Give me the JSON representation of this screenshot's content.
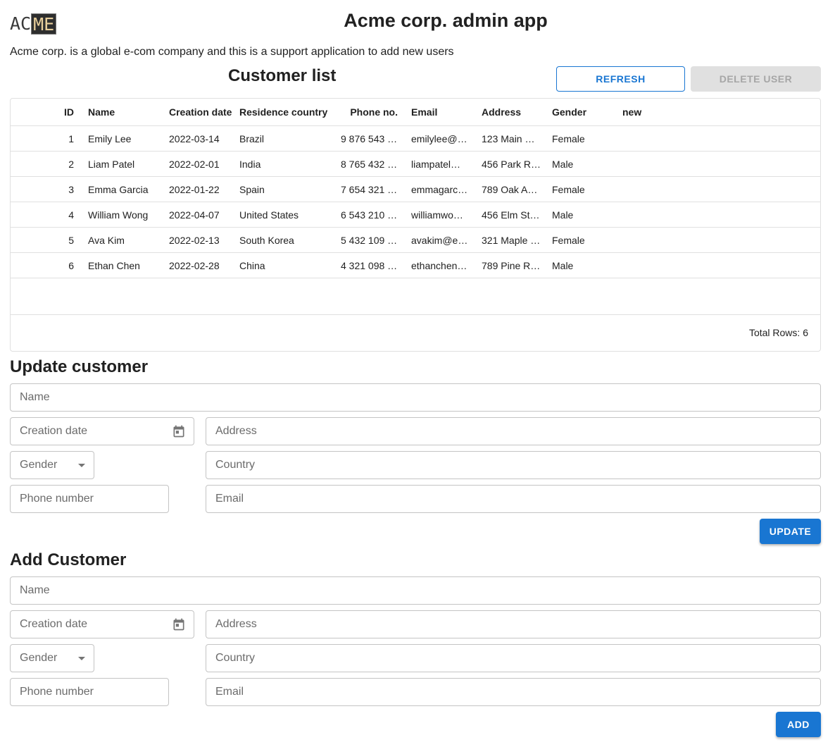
{
  "logo": {
    "plain": "AC",
    "boxed": "ME"
  },
  "app_title": "Acme corp. admin app",
  "intro": "Acme corp. is a global e-com company and this is a support application to add new users",
  "list_title": "Customer list",
  "buttons": {
    "refresh": "REFRESH",
    "delete": "DELETE USER",
    "update": "UPDATE",
    "add": "ADD"
  },
  "table": {
    "columns": [
      "ID",
      "Name",
      "Creation date",
      "Residence country",
      "Phone no.",
      "Email",
      "Address",
      "Gender",
      "new"
    ],
    "rows": [
      [
        "1",
        "Emily Lee",
        "2022-03-14",
        "Brazil",
        "9 876 543 …",
        "emilylee@…",
        "123 Main …",
        "Female",
        ""
      ],
      [
        "2",
        "Liam Patel",
        "2022-02-01",
        "India",
        "8 765 432 …",
        "liampatel…",
        "456 Park R…",
        "Male",
        ""
      ],
      [
        "3",
        "Emma Garcia",
        "2022-01-22",
        "Spain",
        "7 654 321 …",
        "emmagarc…",
        "789 Oak A…",
        "Female",
        ""
      ],
      [
        "4",
        "William Wong",
        "2022-04-07",
        "United States",
        "6 543 210 …",
        "williamwo…",
        "456 Elm St…",
        "Male",
        ""
      ],
      [
        "5",
        "Ava Kim",
        "2022-02-13",
        "South Korea",
        "5 432 109 …",
        "avakim@e…",
        "321 Maple …",
        "Female",
        ""
      ],
      [
        "6",
        "Ethan Chen",
        "2022-02-28",
        "China",
        "4 321 098 …",
        "ethanchen…",
        "789 Pine R…",
        "Male",
        ""
      ]
    ],
    "total_rows": "Total Rows: 6"
  },
  "update_form": {
    "title": "Update customer",
    "name": "Name",
    "creation_date": "Creation date",
    "address": "Address",
    "gender": "Gender",
    "country": "Country",
    "phone": "Phone number",
    "email": "Email"
  },
  "add_form": {
    "title": "Add Customer",
    "name": "Name",
    "creation_date": "Creation date",
    "address": "Address",
    "gender": "Gender",
    "country": "Country",
    "phone": "Phone number",
    "email": "Email"
  },
  "icons": {
    "calendar": "calendar-icon",
    "dropdown": "chevron-down-icon"
  },
  "colors": {
    "primary": "#1976d2",
    "disabled_bg": "#e0e0e0",
    "disabled_text": "#a6a6a6"
  }
}
